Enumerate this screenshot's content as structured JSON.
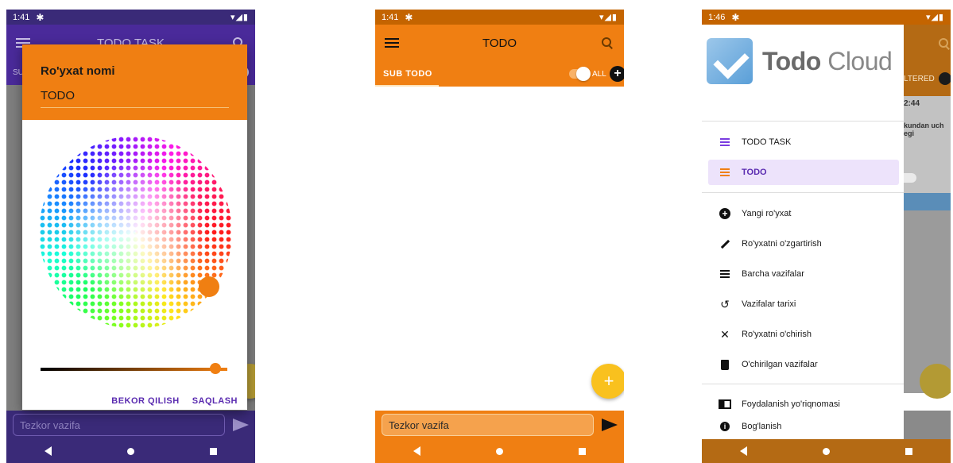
{
  "phone1": {
    "status_time": "1:41",
    "appbar_title": "TODO TASK",
    "subtab_stub": "SU",
    "dialog_title": "Ro'yxat nomi",
    "dialog_name": "TODO",
    "cancel_label": "BEKOR QILISH",
    "save_label": "SAQLASH",
    "quick_placeholder": "Tezkor vazifa",
    "selected_color": "#f07f12"
  },
  "phone2": {
    "status_time": "1:41",
    "appbar_title": "TODO",
    "subtab_label": "SUB TODO",
    "all_label": "ALL",
    "fab_label": "+",
    "quick_placeholder": "Tezkor vazifa",
    "accent": "#f07f12"
  },
  "phone3": {
    "status_time": "1:46",
    "logo_bold": "Todo",
    "logo_light": "Cloud",
    "under_filter": "LTERED",
    "under_time": "2:44",
    "under_text": "kundan uch\negi",
    "menu": [
      {
        "label": "TODO TASK",
        "icon": "list-icon"
      },
      {
        "label": "TODO",
        "icon": "list-icon",
        "active": true
      },
      {
        "label": "Yangi ro'yxat",
        "icon": "add-circle-icon"
      },
      {
        "label": "Ro'yxatni o'zgartirish",
        "icon": "pencil-icon"
      },
      {
        "label": "Barcha vazifalar",
        "icon": "list-icon"
      },
      {
        "label": "Vazifalar tarixi",
        "icon": "history-icon"
      },
      {
        "label": "Ro'yxatni o'chirish",
        "icon": "close-icon"
      },
      {
        "label": "O'chirilgan vazifalar",
        "icon": "trash-icon"
      },
      {
        "label": "Foydalanish yo'riqnomasi",
        "icon": "guide-icon"
      },
      {
        "label": "Bog'lanish",
        "icon": "info-icon"
      }
    ]
  }
}
